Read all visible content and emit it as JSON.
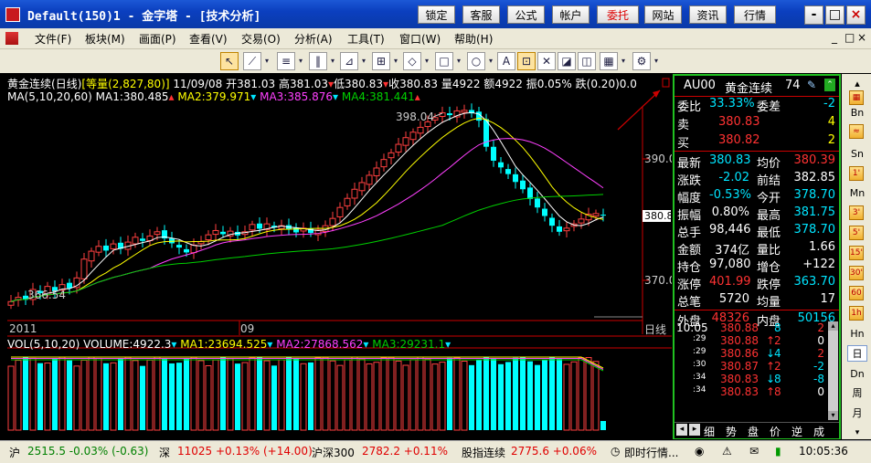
{
  "title": "Default(150)1 - 金字塔 - [技术分析]",
  "top_buttons": [
    "锁定",
    "客服",
    "公式",
    "帐户",
    "委托",
    "网站",
    "资讯",
    "行情"
  ],
  "window_controls": [
    "-",
    "□",
    "×"
  ],
  "menu": [
    "文件(F)",
    "板块(M)",
    "画面(P)",
    "查看(V)",
    "交易(O)",
    "分析(A)",
    "工具(T)",
    "窗口(W)",
    "帮助(H)"
  ],
  "mdi_controls": [
    "_",
    "□",
    "×"
  ],
  "chart": {
    "name": "黄金连续",
    "period": "(日线)",
    "vol_label": "[等量(2,827,80)]",
    "date": "11/09/08",
    "open_label": "开",
    "open": "381.03",
    "high_label": "高",
    "high": "381.03",
    "low_label": "低",
    "low": "380.83",
    "close_label": "收",
    "close": "380.83",
    "volume_label": "量",
    "volume": "4922",
    "amount_label": "额",
    "amount": "4922",
    "amplitude_label": "振",
    "amplitude": "0.05%",
    "change_label": "跌",
    "change": "(0.20)",
    "change_pct": "0.0",
    "ma_header": "MA(5,10,20,60)",
    "ma1": "MA1:380.485",
    "ma2": "MA2:379.971",
    "ma3": "MA3:385.876",
    "ma4": "MA4:381.441",
    "annot_high": "398.04",
    "annot_low": "366.54",
    "current_price_tag": "380.8",
    "y_ticks": [
      "390.0",
      "370.0"
    ],
    "x_labels": [
      "2011",
      "09"
    ],
    "x_unit": "日线",
    "vol_header": "VOL(5,10,20)",
    "vol_value": "VOLUME:4922.3",
    "vol_ma1": "MA1:23694.525",
    "vol_ma2": "MA2:27868.562",
    "vol_ma3": "MA3:29231.1"
  },
  "panel": {
    "code": "AU00",
    "name": "黄金连续",
    "number": "74",
    "rows": [
      {
        "l": "委比",
        "v": "33.33%",
        "vc": "cyan",
        "l2": "委差",
        "v2": "-2",
        "v2c": "cyan"
      },
      {
        "l": "卖",
        "v": "380.83",
        "vc": "red",
        "l2": "",
        "v2": "4",
        "v2c": "yellow",
        "sell": true
      },
      {
        "l": "买",
        "v": "380.82",
        "vc": "red",
        "l2": "",
        "v2": "2",
        "v2c": "yellow",
        "buy": true
      },
      {
        "l": "最新",
        "v": "380.83",
        "vc": "cyan",
        "l2": "均价",
        "v2": "380.39",
        "v2c": "red"
      },
      {
        "l": "涨跌",
        "v": "-2.02",
        "vc": "cyan",
        "l2": "前结",
        "v2": "382.85",
        "v2c": "white"
      },
      {
        "l": "幅度",
        "v": "-0.53%",
        "vc": "cyan",
        "l2": "今开",
        "v2": "378.70",
        "v2c": "cyan"
      },
      {
        "l": "振幅",
        "v": "0.80%",
        "vc": "white",
        "l2": "最高",
        "v2": "381.75",
        "v2c": "cyan"
      },
      {
        "l": "总手",
        "v": "98,446",
        "vc": "white",
        "l2": "最低",
        "v2": "378.70",
        "v2c": "cyan"
      },
      {
        "l": "金额",
        "v": "374亿",
        "vc": "white",
        "l2": "量比",
        "v2": "1.66",
        "v2c": "white"
      },
      {
        "l": "持仓",
        "v": "97,080",
        "vc": "white",
        "l2": "增仓",
        "v2": "+122",
        "v2c": "white"
      },
      {
        "l": "涨停",
        "v": "401.99",
        "vc": "red",
        "l2": "跌停",
        "v2": "363.70",
        "v2c": "cyan"
      },
      {
        "l": "总笔",
        "v": "5720",
        "vc": "white",
        "l2": "均量",
        "v2": "17",
        "v2c": "white"
      },
      {
        "l": "外盘",
        "v": "48326",
        "vc": "red",
        "l2": "内盘",
        "v2": "50156",
        "v2c": "cyan"
      }
    ],
    "ticks": [
      {
        "t": "10:05",
        "p": "380.88",
        "a": "",
        "q": "8",
        "qc": "cyan",
        "d": "2"
      },
      {
        "t": ":29",
        "p": "380.88",
        "a": "↑",
        "q": "2",
        "qc": "red",
        "d": "0"
      },
      {
        "t": ":29",
        "p": "380.86",
        "a": "↓",
        "q": "4",
        "qc": "cyan",
        "d": "2"
      },
      {
        "t": ":30",
        "p": "380.87",
        "a": "↑",
        "q": "2",
        "qc": "red",
        "d": "-2"
      },
      {
        "t": ":34",
        "p": "380.83",
        "a": "↓",
        "q": "8",
        "qc": "cyan",
        "d": "-8"
      },
      {
        "t": ":34",
        "p": "380.83",
        "a": "↑",
        "q": "8",
        "qc": "red",
        "d": "0"
      }
    ],
    "tabs": [
      "细",
      "势",
      "盘",
      "价",
      "逆",
      "成"
    ]
  },
  "sidebar": [
    "Bn",
    "Sn",
    "Mn",
    "Hn",
    "日",
    "Dn",
    "周",
    "月"
  ],
  "sidebar_icons": [
    "1'",
    "3'",
    "5'",
    "15'",
    "30'"
  ],
  "status": {
    "sh_label": "沪",
    "sh": "2515.5 -0.03% (-0.63)",
    "sz_label": "深",
    "sz": "11025 +0.13% (+14.00)",
    "hs300_label": "沪深300",
    "hs300": "2782.2 +0.11%",
    "gz_label": "股指连续",
    "gz": "2775.6 +0.06%",
    "news": "即时行情...",
    "time": "10:05:36"
  }
}
